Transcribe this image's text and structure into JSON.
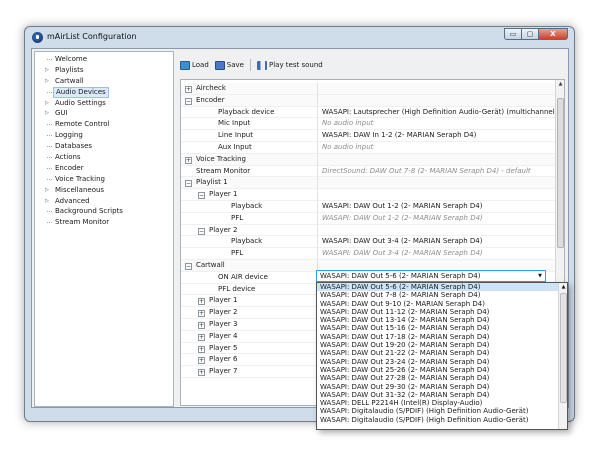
{
  "window": {
    "title": "mAirList Configuration"
  },
  "caption_buttons": [
    "▭",
    "▢",
    "X"
  ],
  "sidebar": {
    "items": [
      {
        "label": "Welcome",
        "expandable": false
      },
      {
        "label": "Playlists",
        "expandable": true
      },
      {
        "label": "Cartwall",
        "expandable": true
      },
      {
        "label": "Audio Devices",
        "expandable": false,
        "selected": true
      },
      {
        "label": "Audio Settings",
        "expandable": true
      },
      {
        "label": "GUI",
        "expandable": true
      },
      {
        "label": "Remote Control",
        "expandable": false
      },
      {
        "label": "Logging",
        "expandable": false
      },
      {
        "label": "Databases",
        "expandable": false
      },
      {
        "label": "Actions",
        "expandable": false
      },
      {
        "label": "Encoder",
        "expandable": false
      },
      {
        "label": "Voice Tracking",
        "expandable": false
      },
      {
        "label": "Miscellaneous",
        "expandable": true
      },
      {
        "label": "Advanced",
        "expandable": true
      },
      {
        "label": "Background Scripts",
        "expandable": false
      },
      {
        "label": "Stream Monitor",
        "expandable": false
      }
    ]
  },
  "toolbar": {
    "load_label": "Load",
    "save_label": "Save",
    "test_label": "Play test sound"
  },
  "grid": {
    "rows": [
      {
        "level": 0,
        "box": "+",
        "name": "Aircheck",
        "value": "",
        "dim": false
      },
      {
        "level": 0,
        "box": "−",
        "name": "Encoder",
        "value": "",
        "dim": false
      },
      {
        "level": 1,
        "box": "",
        "name": "Playback device",
        "value": "WASAPI: Lautsprecher (High Definition Audio-Gerät) (multichannel)",
        "dim": false
      },
      {
        "level": 1,
        "box": "",
        "name": "Mic Input",
        "value": "No audio input",
        "dim": true
      },
      {
        "level": 1,
        "box": "",
        "name": "Line Input",
        "value": "WASAPI: DAW In  1-2 (2- MARIAN Seraph D4)",
        "dim": false
      },
      {
        "level": 1,
        "box": "",
        "name": "Aux Input",
        "value": "No audio input",
        "dim": true
      },
      {
        "level": 0,
        "box": "+",
        "name": "Voice Tracking",
        "value": "",
        "dim": false
      },
      {
        "level": 0,
        "box": "",
        "name": "Stream Monitor",
        "value": "DirectSound: DAW Out  7-8 (2- MARIAN Seraph D4) - default",
        "dim": true
      },
      {
        "level": 0,
        "box": "−",
        "name": "Playlist 1",
        "value": "",
        "dim": false
      },
      {
        "level": 1,
        "box": "−",
        "name": "Player 1",
        "value": "",
        "dim": false
      },
      {
        "level": 2,
        "box": "",
        "name": "Playback",
        "value": "WASAPI: DAW Out  1-2 (2- MARIAN Seraph D4)",
        "dim": false
      },
      {
        "level": 2,
        "box": "",
        "name": "PFL",
        "value": "WASAPI: DAW Out  1-2 (2- MARIAN Seraph D4)",
        "dim": true
      },
      {
        "level": 1,
        "box": "−",
        "name": "Player 2",
        "value": "",
        "dim": false
      },
      {
        "level": 2,
        "box": "",
        "name": "Playback",
        "value": "WASAPI: DAW Out  3-4 (2- MARIAN Seraph D4)",
        "dim": false
      },
      {
        "level": 2,
        "box": "",
        "name": "PFL",
        "value": "WASAPI: DAW Out  3-4 (2- MARIAN Seraph D4)",
        "dim": true
      },
      {
        "level": 0,
        "box": "−",
        "name": "Cartwall",
        "value": "",
        "dim": false
      },
      {
        "level": 1,
        "box": "",
        "name": "ON AIR device",
        "value": "",
        "dim": false
      },
      {
        "level": 1,
        "box": "",
        "name": "PFL device",
        "value": "",
        "dim": false
      },
      {
        "level": 1,
        "box": "+",
        "name": "Player 1",
        "value": "",
        "dim": false
      },
      {
        "level": 1,
        "box": "+",
        "name": "Player 2",
        "value": "",
        "dim": false
      },
      {
        "level": 1,
        "box": "+",
        "name": "Player 3",
        "value": "",
        "dim": false
      },
      {
        "level": 1,
        "box": "+",
        "name": "Player 4",
        "value": "",
        "dim": false
      },
      {
        "level": 1,
        "box": "+",
        "name": "Player 5",
        "value": "",
        "dim": false
      },
      {
        "level": 1,
        "box": "+",
        "name": "Player 6",
        "value": "",
        "dim": false
      },
      {
        "level": 1,
        "box": "+",
        "name": "Player 7",
        "value": "",
        "dim": false
      }
    ]
  },
  "combo": {
    "selected": "WASAPI: DAW Out  5-6 (2- MARIAN Seraph D4)"
  },
  "dropdown": {
    "options": [
      "WASAPI: DAW Out  5-6 (2- MARIAN Seraph D4)",
      "WASAPI: DAW Out  7-8 (2- MARIAN Seraph D4)",
      "WASAPI: DAW Out  9-10 (2- MARIAN Seraph D4)",
      "WASAPI: DAW Out 11-12 (2- MARIAN Seraph D4)",
      "WASAPI: DAW Out 13-14 (2- MARIAN Seraph D4)",
      "WASAPI: DAW Out 15-16 (2- MARIAN Seraph D4)",
      "WASAPI: DAW Out 17-18 (2- MARIAN Seraph D4)",
      "WASAPI: DAW Out 19-20 (2- MARIAN Seraph D4)",
      "WASAPI: DAW Out 21-22 (2- MARIAN Seraph D4)",
      "WASAPI: DAW Out 23-24 (2- MARIAN Seraph D4)",
      "WASAPI: DAW Out 25-26 (2- MARIAN Seraph D4)",
      "WASAPI: DAW Out 27-28 (2- MARIAN Seraph D4)",
      "WASAPI: DAW Out 29-30 (2- MARIAN Seraph D4)",
      "WASAPI: DAW Out 31-32 (2- MARIAN Seraph D4)",
      "WASAPI: DELL P2214H (Intel(R) Display-Audio)",
      "WASAPI: Digitalaudio (S/PDIF) (High Definition Audio-Gerät)",
      "WASAPI: Digitalaudio (S/PDIF) (High Definition Audio-Gerät)"
    ],
    "highlighted_index": 0
  },
  "colors": {
    "accent": "#3399ff",
    "selection": "#dce9f8",
    "window_frame": "#cfdcea"
  }
}
